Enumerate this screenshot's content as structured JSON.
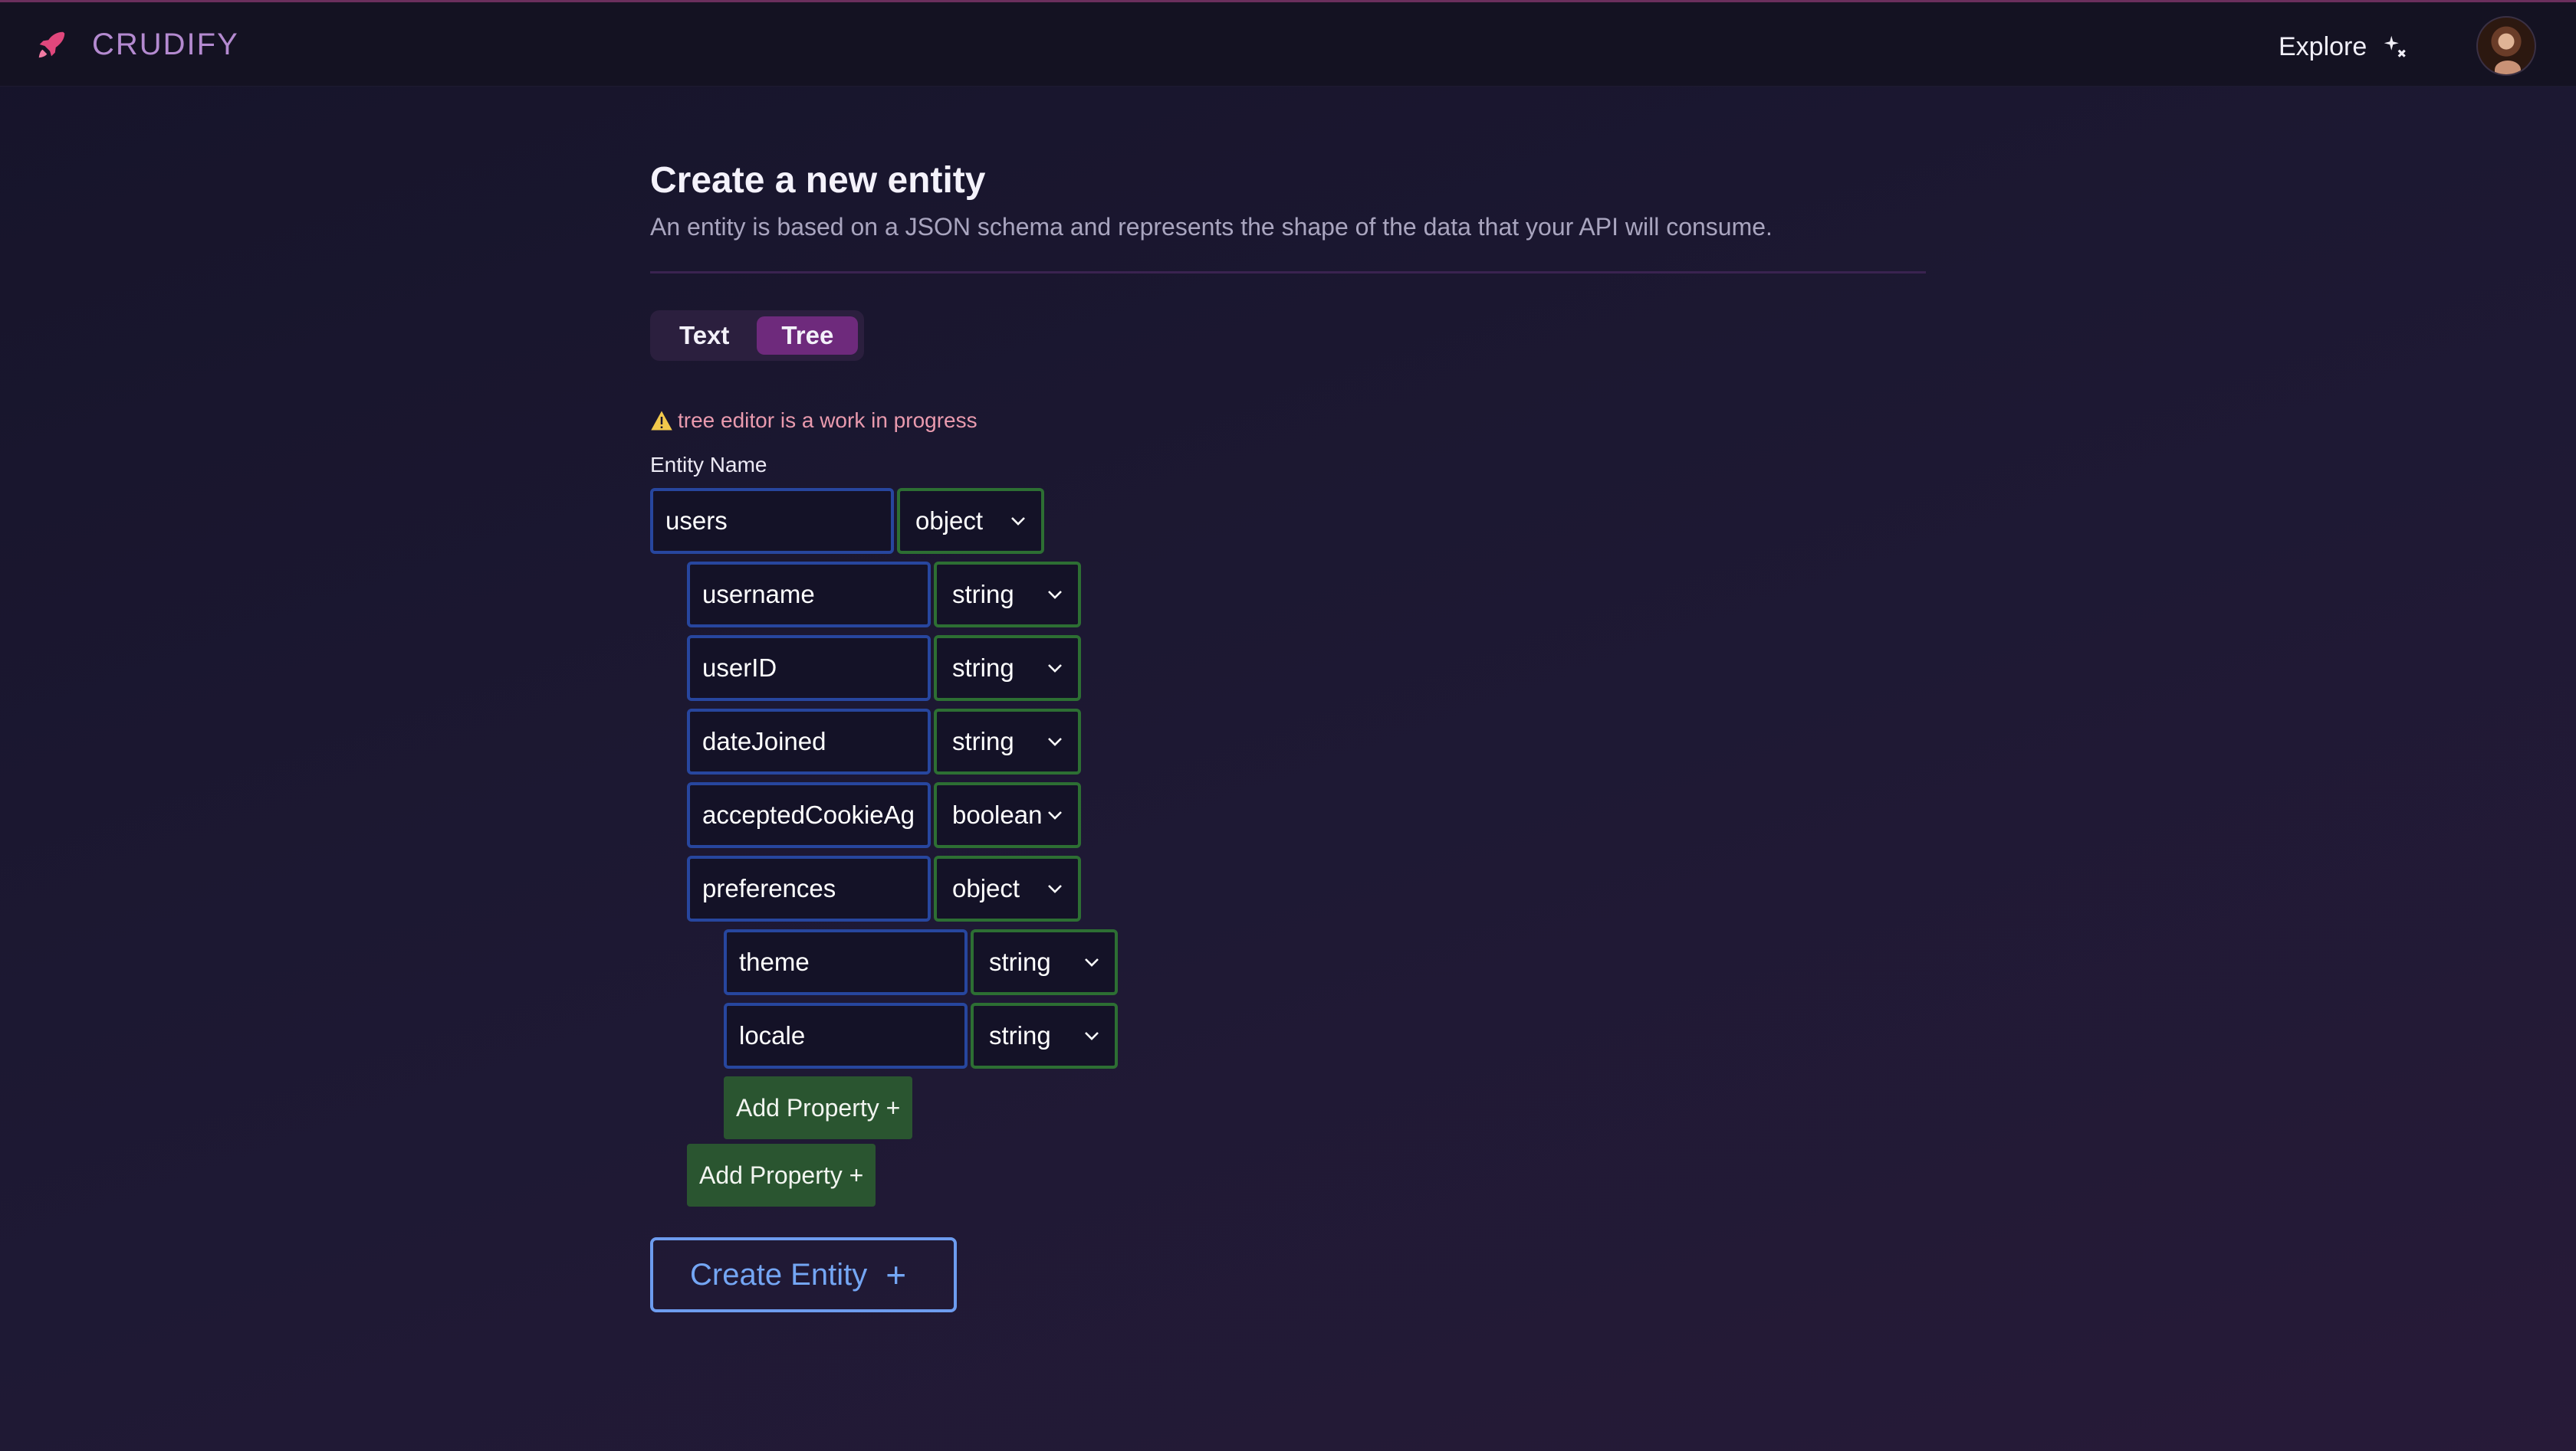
{
  "nav": {
    "brand": "CRUDIFY",
    "explore_label": "Explore"
  },
  "page": {
    "title": "Create a new entity",
    "subtitle": "An entity is based on a JSON schema and represents the shape of the data that your API will consume."
  },
  "editor_toggle": {
    "options": [
      "Text",
      "Tree"
    ],
    "active": "Tree"
  },
  "warning": "tree editor is a work in progress",
  "entity": {
    "label": "Entity Name",
    "name": "users",
    "type": "object",
    "properties": [
      {
        "name": "username",
        "type": "string"
      },
      {
        "name": "userID",
        "type": "string"
      },
      {
        "name": "dateJoined",
        "type": "string"
      },
      {
        "name": "acceptedCookieAgr",
        "type": "boolean"
      },
      {
        "name": "preferences",
        "type": "object"
      }
    ],
    "nested_properties": [
      {
        "name": "theme",
        "type": "string"
      },
      {
        "name": "locale",
        "type": "string"
      }
    ]
  },
  "buttons": {
    "add_property": "Add Property +",
    "create_entity": "Create Entity",
    "create_entity_icon": "+"
  },
  "colors": {
    "brand": "#b48ad0",
    "toggle_active": "#6e2a7c",
    "name_border": "#27469e",
    "type_border": "#2d6f33",
    "add_button": "#2a5530",
    "create_button": "#74a6f4",
    "warning_text": "#e99aae"
  }
}
